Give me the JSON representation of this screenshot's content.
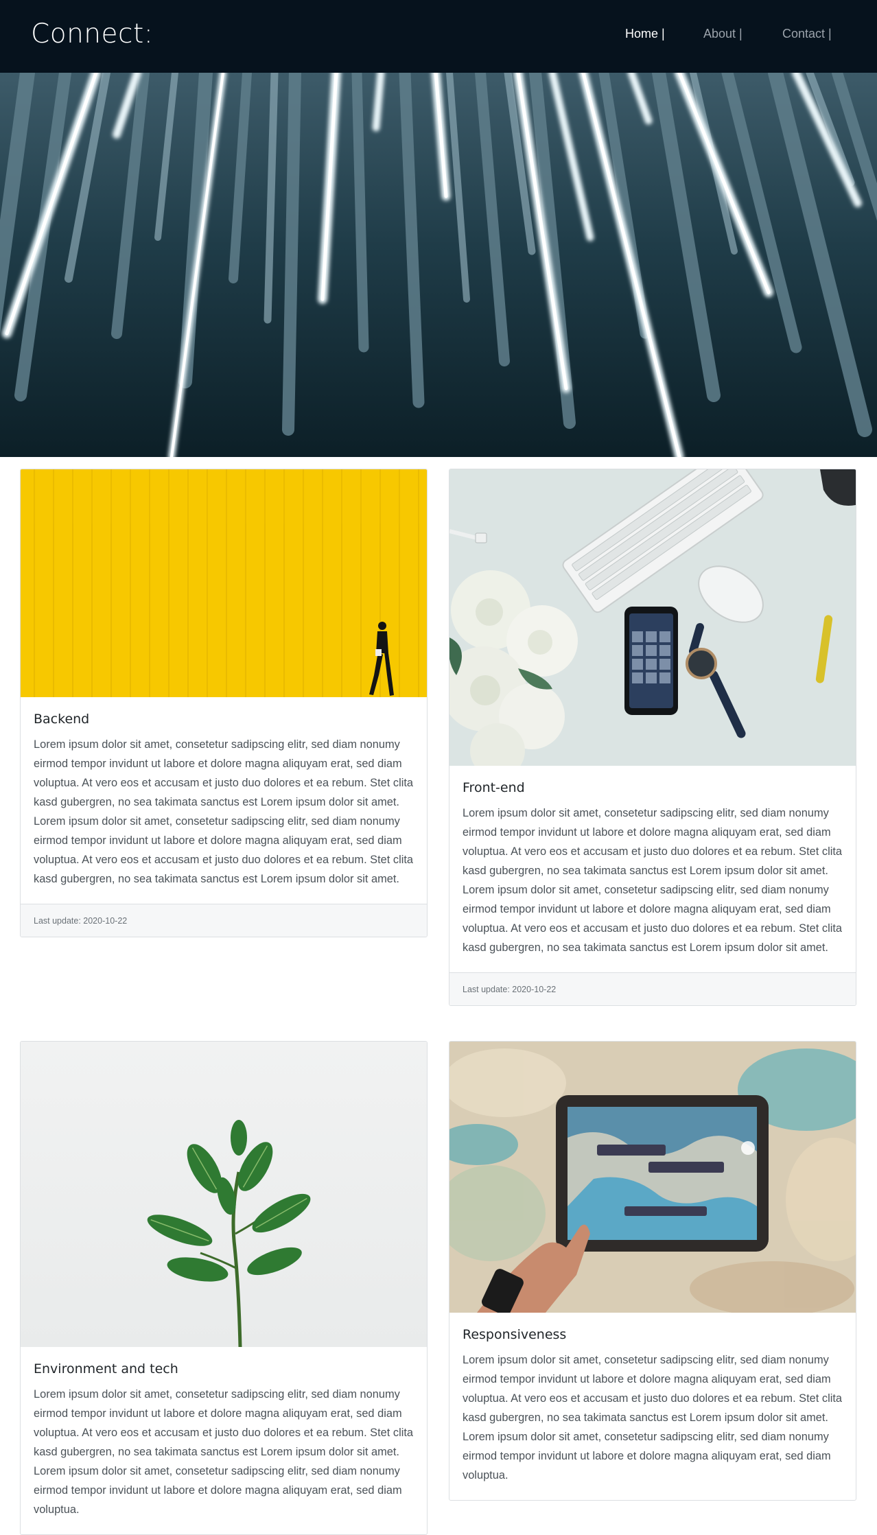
{
  "navbar": {
    "brand": "Connect:",
    "links": [
      {
        "label": "Home |",
        "active": true
      },
      {
        "label": "About |",
        "active": false
      },
      {
        "label": "Contact |",
        "active": false
      }
    ]
  },
  "cards": [
    {
      "title": "Backend",
      "text": "Lorem ipsum dolor sit amet, consetetur sadipscing elitr, sed diam nonumy eirmod tempor invidunt ut labore et dolore magna aliquyam erat, sed diam voluptua. At vero eos et accusam et justo duo dolores et ea rebum. Stet clita kasd gubergren, no sea takimata sanctus est Lorem ipsum dolor sit amet. Lorem ipsum dolor sit amet, consetetur sadipscing elitr, sed diam nonumy eirmod tempor invidunt ut labore et dolore magna aliquyam erat, sed diam voluptua. At vero eos et accusam et justo duo dolores et ea rebum. Stet clita kasd gubergren, no sea takimata sanctus est Lorem ipsum dolor sit amet.",
      "footer": "Last update: 2020-10-22"
    },
    {
      "title": "Front-end",
      "text": "Lorem ipsum dolor sit amet, consetetur sadipscing elitr, sed diam nonumy eirmod tempor invidunt ut labore et dolore magna aliquyam erat, sed diam voluptua. At vero eos et accusam et justo duo dolores et ea rebum. Stet clita kasd gubergren, no sea takimata sanctus est Lorem ipsum dolor sit amet. Lorem ipsum dolor sit amet, consetetur sadipscing elitr, sed diam nonumy eirmod tempor invidunt ut labore et dolore magna aliquyam erat, sed diam voluptua. At vero eos et accusam et justo duo dolores et ea rebum. Stet clita kasd gubergren, no sea takimata sanctus est Lorem ipsum dolor sit amet.",
      "footer": "Last update: 2020-10-22"
    },
    {
      "title": "Environment and tech",
      "text": "Lorem ipsum dolor sit amet, consetetur sadipscing elitr, sed diam nonumy eirmod tempor invidunt ut labore et dolore magna aliquyam erat, sed diam voluptua. At vero eos et accusam et justo duo dolores et ea rebum. Stet clita kasd gubergren, no sea takimata sanctus est Lorem ipsum dolor sit amet. Lorem ipsum dolor sit amet, consetetur sadipscing elitr, sed diam nonumy eirmod tempor invidunt ut labore et dolore magna aliquyam erat, sed diam voluptua.",
      "footer": ""
    },
    {
      "title": "Responsiveness",
      "text": "Lorem ipsum dolor sit amet, consetetur sadipscing elitr, sed diam nonumy eirmod tempor invidunt ut labore et dolore magna aliquyam erat, sed diam voluptua. At vero eos et accusam et justo duo dolores et ea rebum. Stet clita kasd gubergren, no sea takimata sanctus est Lorem ipsum dolor sit amet. Lorem ipsum dolor sit amet, consetetur sadipscing elitr, sed diam nonumy eirmod tempor invidunt ut labore et dolore magna aliquyam erat, sed diam voluptua.",
      "footer": ""
    }
  ],
  "colors": {
    "navbar_bg": "#06121d",
    "nav_link": "#9ba3ab",
    "nav_link_active": "#ffffff",
    "card_border": "#dcdfe2",
    "card_footer_bg": "#f6f7f8"
  }
}
